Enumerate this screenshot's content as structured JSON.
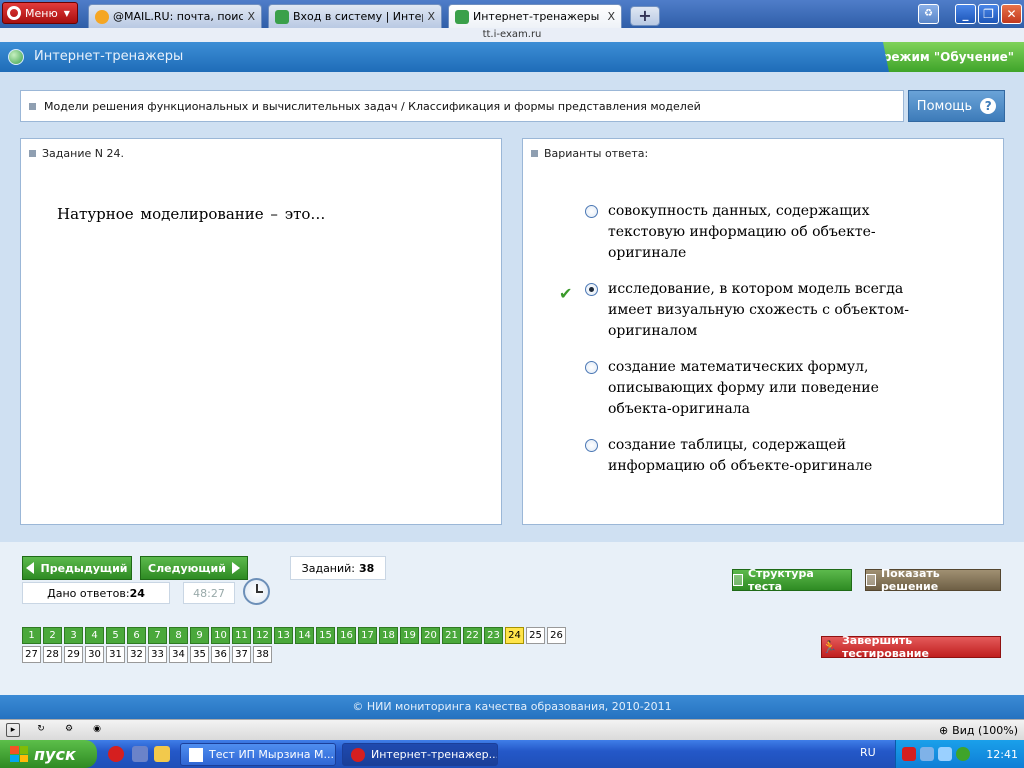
{
  "browser": {
    "menu_label": "Меню",
    "tabs": [
      {
        "label": "@MAIL.RU: почта, поиск...",
        "active": false
      },
      {
        "label": "Вход в систему | Интер...",
        "active": false
      },
      {
        "label": "Интернет-тренажеры",
        "active": true
      }
    ],
    "close_glyph": "X",
    "new_tab_glyph": "+",
    "url": "tt.i-exam.ru"
  },
  "app": {
    "title": "Интернет-тренажеры",
    "mode": "режим \"Обучение\""
  },
  "breadcrumb": "Модели решения функциональных и вычислительных задач / Классификация и формы представления моделей",
  "help_label": "Помощь",
  "task": {
    "header": "Задание N 24.",
    "question": "Натурное  моделирование – это…"
  },
  "answers": {
    "header": "Варианты ответа:",
    "options": [
      {
        "text": "совокупность данных, содержащих текстовую информацию об объекте-оригинале",
        "selected": false
      },
      {
        "text": "исследование, в котором модель всегда имеет визуальную схожесть с объектом-оригиналом",
        "selected": true
      },
      {
        "text": "создание математических формул, описывающих форму или поведение объекта-оригинала",
        "selected": false
      },
      {
        "text": "создание таблицы, содержащей информацию об объекте-оригинале",
        "selected": false
      }
    ]
  },
  "nav": {
    "prev_label": "Предыдущий",
    "next_label": "Следующий",
    "tasks_label": "Заданий:",
    "tasks_count": "38",
    "answered_label": "Дано ответов:",
    "answered_count": "24",
    "timer": "48:27",
    "structure_label": "Структура теста",
    "show_solution_label": "Показать решение",
    "finish_label": "Завершить тестирование",
    "questions": [
      {
        "n": "1",
        "state": "answered"
      },
      {
        "n": "2",
        "state": "answered"
      },
      {
        "n": "3",
        "state": "answered"
      },
      {
        "n": "4",
        "state": "answered"
      },
      {
        "n": "5",
        "state": "answered"
      },
      {
        "n": "6",
        "state": "answered"
      },
      {
        "n": "7",
        "state": "answered"
      },
      {
        "n": "8",
        "state": "answered"
      },
      {
        "n": "9",
        "state": "answered"
      },
      {
        "n": "10",
        "state": "answered"
      },
      {
        "n": "11",
        "state": "answered"
      },
      {
        "n": "12",
        "state": "answered"
      },
      {
        "n": "13",
        "state": "answered"
      },
      {
        "n": "14",
        "state": "answered"
      },
      {
        "n": "15",
        "state": "answered"
      },
      {
        "n": "16",
        "state": "answered"
      },
      {
        "n": "17",
        "state": "answered"
      },
      {
        "n": "18",
        "state": "answered"
      },
      {
        "n": "19",
        "state": "answered"
      },
      {
        "n": "20",
        "state": "answered"
      },
      {
        "n": "21",
        "state": "answered"
      },
      {
        "n": "22",
        "state": "answered"
      },
      {
        "n": "23",
        "state": "answered"
      },
      {
        "n": "24",
        "state": "current"
      },
      {
        "n": "25",
        "state": "pending"
      },
      {
        "n": "26",
        "state": "pending"
      },
      {
        "n": "27",
        "state": "pending"
      },
      {
        "n": "28",
        "state": "pending"
      },
      {
        "n": "29",
        "state": "pending"
      },
      {
        "n": "30",
        "state": "pending"
      },
      {
        "n": "31",
        "state": "pending"
      },
      {
        "n": "32",
        "state": "pending"
      },
      {
        "n": "33",
        "state": "pending"
      },
      {
        "n": "34",
        "state": "pending"
      },
      {
        "n": "35",
        "state": "pending"
      },
      {
        "n": "36",
        "state": "pending"
      },
      {
        "n": "37",
        "state": "pending"
      },
      {
        "n": "38",
        "state": "pending"
      }
    ]
  },
  "footer": "© НИИ мониторинга качества образования, 2010-2011",
  "statusbar": {
    "zoom": "Вид (100%)"
  },
  "taskbar": {
    "start": "пуск",
    "tasks": [
      {
        "label": "Тест ИП Мырзина М...",
        "active": false
      },
      {
        "label": "Интернет-тренажер...",
        "active": true
      }
    ],
    "lang": "RU",
    "time": "12:41"
  },
  "colors": {
    "answered": "#4aa83b",
    "current": "#ffe44a",
    "header_blue": "#2f7ac6",
    "mode_green": "#4fb132",
    "finish_red": "#d33a3a"
  }
}
